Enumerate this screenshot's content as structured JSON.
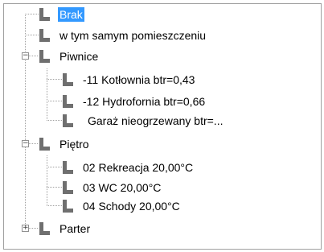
{
  "tree": {
    "nodes": [
      {
        "label": "Brak",
        "selected": true
      },
      {
        "label": "w tym samym pomieszczeniu"
      },
      {
        "label": "Piwnice",
        "expander": "−"
      },
      {
        "label": "-11 Kotłownia btr=0,43"
      },
      {
        "label": "-12 Hydrofornia btr=0,66"
      },
      {
        "label": "Garaż nieogrzewany btr=..."
      },
      {
        "label": "Piętro",
        "expander": "−"
      },
      {
        "label": "02 Rekreacja 20,00°C"
      },
      {
        "label": "03 WC 20,00°C"
      },
      {
        "label": "04 Schody 20,00°C"
      },
      {
        "label": "Parter",
        "expander": "+"
      }
    ]
  }
}
